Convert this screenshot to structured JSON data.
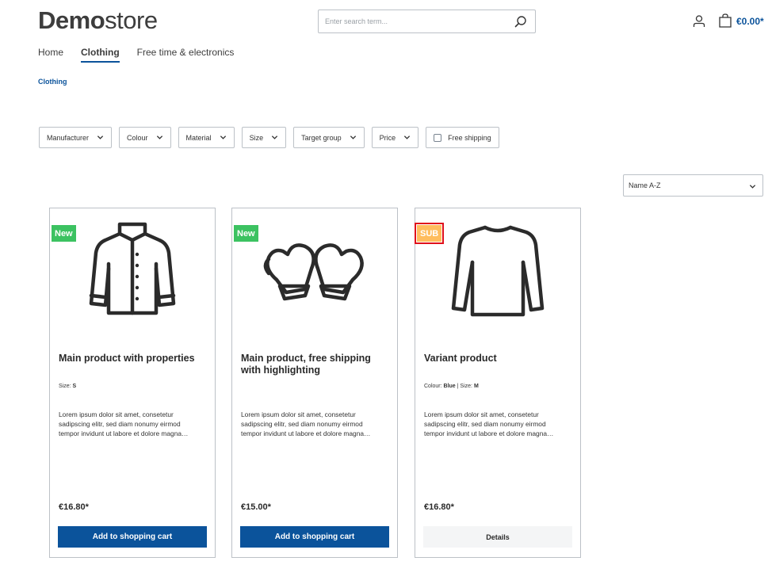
{
  "header": {
    "logo_bold": "Demo",
    "logo_light": "store",
    "search_placeholder": "Enter search term...",
    "cart_total": "€0.00*"
  },
  "nav": {
    "items": [
      {
        "label": "Home"
      },
      {
        "label": "Clothing"
      },
      {
        "label": "Free time & electronics"
      }
    ]
  },
  "breadcrumb": "Clothing",
  "filters": [
    {
      "label": "Manufacturer"
    },
    {
      "label": "Colour"
    },
    {
      "label": "Material"
    },
    {
      "label": "Size"
    },
    {
      "label": "Target group"
    },
    {
      "label": "Price"
    }
  ],
  "free_shipping_label": "Free shipping",
  "sort_selected": "Name A-Z",
  "products": [
    {
      "badge": "New",
      "name": "Main product with properties",
      "props": [
        {
          "label": "Size:",
          "value": "S"
        }
      ],
      "desc_lines": [
        "Lorem ipsum dolor sit amet, consetetur",
        "sadipscing elitr, sed diam nonumy eirmod",
        "tempor invidunt ut labore et dolore magna…"
      ],
      "price": "€16.80*",
      "button": "Add to shopping cart"
    },
    {
      "badge": "New",
      "name": "Main product, free shipping with highlighting",
      "props": [],
      "desc_lines": [
        "Lorem ipsum dolor sit amet, consetetur",
        "sadipscing elitr, sed diam nonumy eirmod",
        "tempor invidunt ut labore et dolore magna…"
      ],
      "price": "€15.00*",
      "button": "Add to shopping cart"
    },
    {
      "badge": "SUB",
      "name": "Variant product",
      "props": [
        {
          "label": "Colour:",
          "value": "Blue"
        },
        {
          "label": "Size:",
          "value": "M"
        }
      ],
      "desc_lines": [
        "Lorem ipsum dolor sit amet, consetetur",
        "sadipscing elitr, sed diam nonumy eirmod",
        "tempor invidunt ut labore et dolore magna…"
      ],
      "price": "€16.80*",
      "button": "Details"
    }
  ],
  "colors": {
    "primary": "#0b539b",
    "new_badge": "#3cc261",
    "sub_badge": "#ffbd5d",
    "highlight_outline": "#e0111b"
  },
  "icons": [
    "search-icon",
    "account-icon",
    "cart-icon",
    "chevron-down-icon",
    "jacket-icon",
    "mittens-icon",
    "longsleeve-icon"
  ]
}
